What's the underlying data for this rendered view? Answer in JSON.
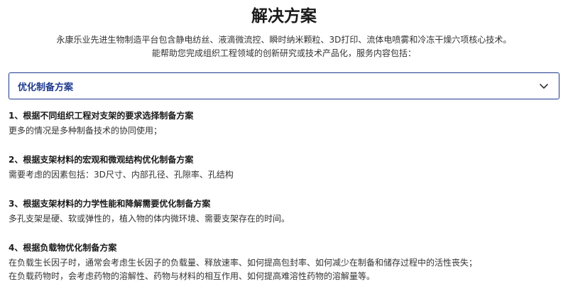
{
  "page": {
    "title": "解决方案",
    "intro_lines": [
      "永康乐业先进生物制造平台包含静电纺丝、液滴微流控、瞬时纳米颗粒、3D打印、流体电喷雾和冷冻干燥六项核心技术。",
      "能帮助您完成组织工程领域的创新研究或技术产品化，服务内容包括："
    ]
  },
  "accordion": {
    "label": "优化制备方案",
    "icon": "chevron-down-icon",
    "accent_color": "#1f3b8f"
  },
  "items": [
    {
      "title": "1、根据不同组织工程对支架的要求选择制备方案",
      "lines": [
        "更多的情况是多种制备技术的协同使用；"
      ]
    },
    {
      "title": "2、根据支架材料的宏观和微观结构优化制备方案",
      "lines": [
        "需要考虑的因素包括：3D尺寸、内部孔径、孔隙率、孔结构"
      ]
    },
    {
      "title": "3、根据支架材料的力学性能和降解需要优化制备方案",
      "lines": [
        "多孔支架是硬、软或弹性的，植入物的体内微环境、需要支架存在的时间。"
      ]
    },
    {
      "title": "4、根据负载物优化制备方案",
      "lines": [
        "在负载生长因子时，通常会考虑生长因子的负载量、释放速率、如何提高包封率、如何减少在制备和储存过程中的活性丧失；",
        "在负载药物时，会考虑药物的溶解性、药物与材料的相互作用、如何提高难溶性药物的溶解量等。"
      ]
    }
  ]
}
